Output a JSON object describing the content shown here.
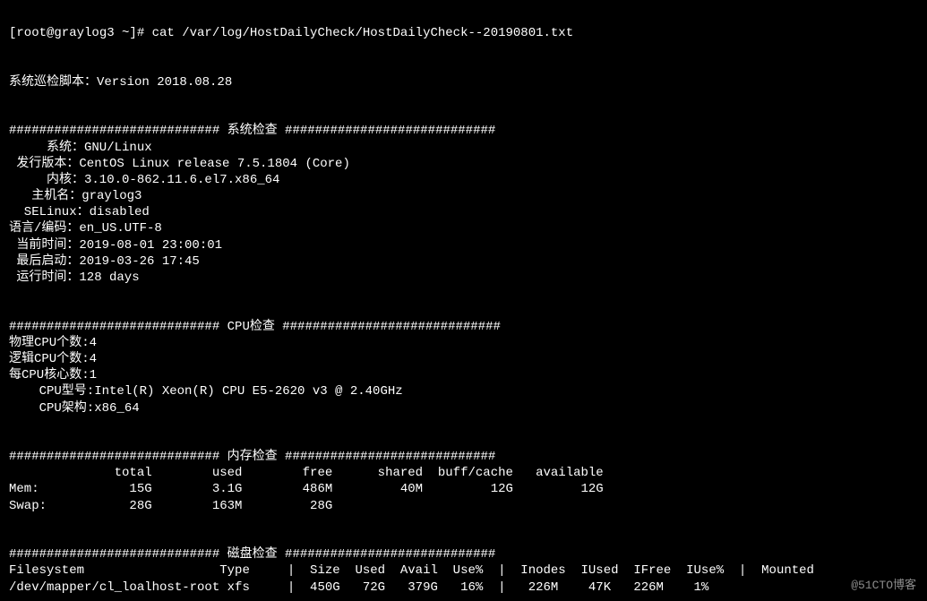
{
  "prompt_line": "[root@graylog3 ~]# cat /var/log/HostDailyCheck/HostDailyCheck--20190801.txt",
  "blank1": "",
  "blank2": "",
  "version_line": "系统巡检脚本：Version 2018.08.28",
  "blank3": "",
  "blank4": "",
  "sys_header": "############################ 系统检查 ############################",
  "sys_os": "     系统：GNU/Linux",
  "sys_release": " 发行版本：CentOS Linux release 7.5.1804 (Core)",
  "sys_kernel": "     内核：3.10.0-862.11.6.el7.x86_64",
  "sys_hostname": "   主机名：graylog3",
  "sys_selinux": "  SELinux：disabled",
  "sys_locale": "语言/编码：en_US.UTF-8",
  "sys_curtime": " 当前时间：2019-08-01 23:00:01",
  "sys_lastboot": " 最后启动：2019-03-26 17:45",
  "sys_uptime": " 运行时间：128 days",
  "blank5": "",
  "blank6": "",
  "cpu_header": "############################ CPU检查 #############################",
  "cpu_phys": "物理CPU个数:4",
  "cpu_logic": "逻辑CPU个数:4",
  "cpu_core": "每CPU核心数:1",
  "cpu_model": "    CPU型号:Intel(R) Xeon(R) CPU E5-2620 v3 @ 2.40GHz",
  "cpu_arch": "    CPU架构:x86_64",
  "blank7": "",
  "blank8": "",
  "mem_header": "############################ 内存检查 ############################",
  "mem_cols": "              total        used        free      shared  buff/cache   available",
  "mem_row": "Mem:            15G        3.1G        486M         40M         12G         12G",
  "swap_row": "Swap:           28G        163M         28G",
  "blank9": "",
  "blank10": "",
  "disk_header": "############################ 磁盘检查 ############################",
  "disk_cols": "Filesystem                  Type     |  Size  Used  Avail  Use%  |  Inodes  IUsed  IFree  IUse%  |  Mounted",
  "disk_row1": "/dev/mapper/cl_loalhost-root xfs     |  450G   72G   379G   16%  |   226M    47K   226M    1%",
  "watermark": "@51CTO博客"
}
